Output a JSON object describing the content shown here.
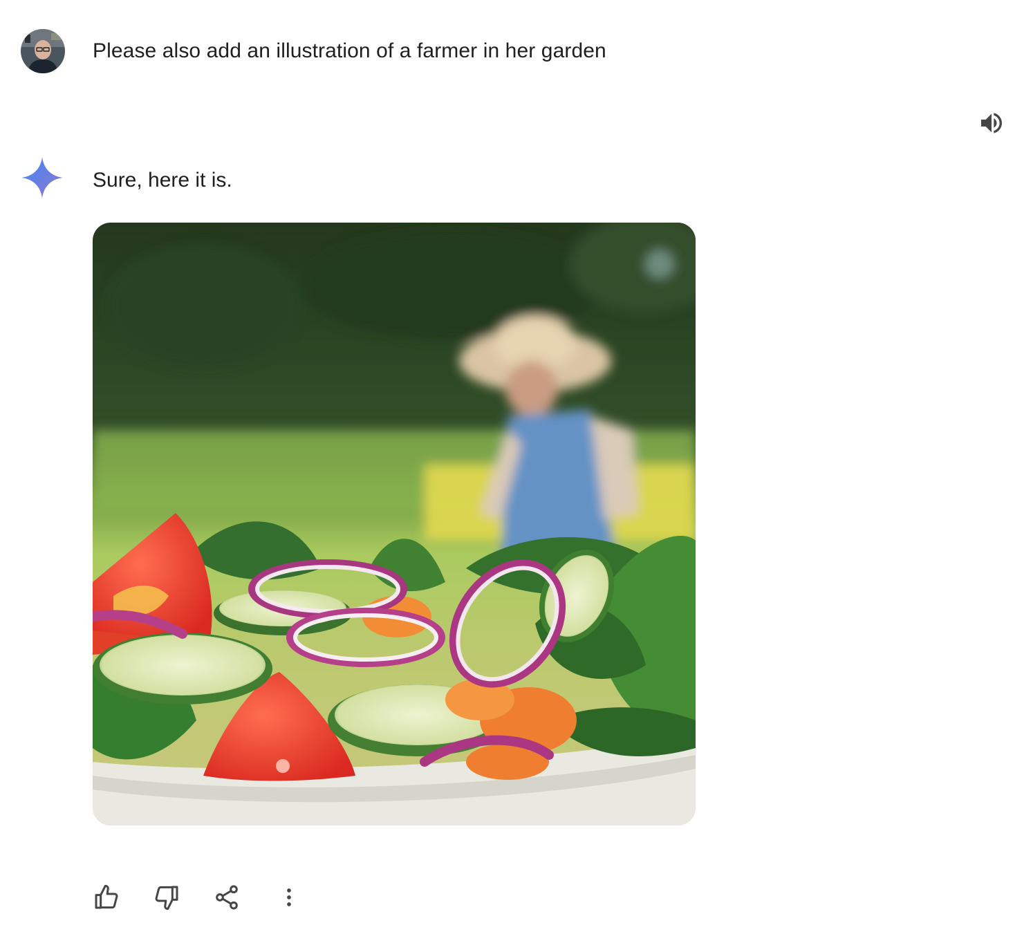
{
  "user": {
    "avatar_icon": "user-avatar",
    "prompt": "Please also add an illustration of a farmer in her garden"
  },
  "response": {
    "assistant_icon": "sparkle-icon",
    "text": "Sure, here it is.",
    "image_subject": "salad bowl in the foreground with a blurred farmer in a straw hat and blue overalls in a garden"
  },
  "toolbar": {
    "speaker_icon": "volume-icon",
    "actions": [
      {
        "icon": "thumbs-up-icon"
      },
      {
        "icon": "thumbs-down-icon"
      },
      {
        "icon": "share-icon"
      },
      {
        "icon": "more-vert-icon"
      }
    ]
  },
  "colors": {
    "text": "#1f1f1f",
    "icon": "#444746",
    "spark_blue": "#4285f4",
    "spark_purple": "#9b72cb"
  }
}
